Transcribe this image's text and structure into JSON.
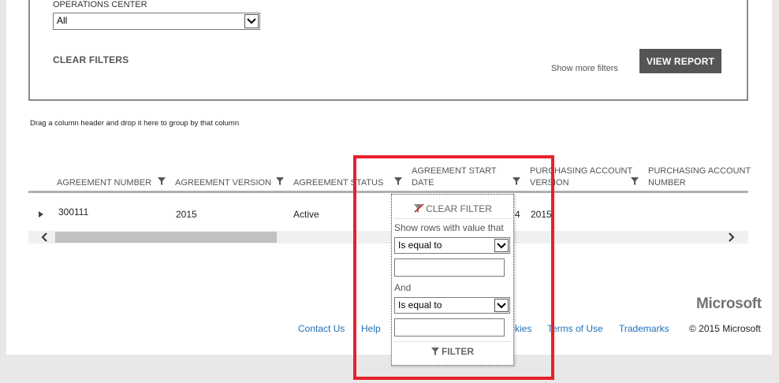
{
  "filters": {
    "operations_center_label": "OPERATIONS CENTER",
    "operations_center_value": "All",
    "clear_filters_label": "CLEAR FILTERS",
    "show_more_filters_label": "Show more filters",
    "view_report_label": "VIEW REPORT"
  },
  "grid": {
    "group_hint": "Drag a column header and drop it here to group by that column",
    "columns": [
      {
        "line1": "",
        "line2": "AGREEMENT NUMBER"
      },
      {
        "line1": "",
        "line2": "AGREEMENT VERSION"
      },
      {
        "line1": "",
        "line2": "AGREEMENT STATUS"
      },
      {
        "line1": "AGREEMENT START",
        "line2": "DATE"
      },
      {
        "line1": "PURCHASING ACCOUNT",
        "line2": "VERSION"
      },
      {
        "line1": "PURCHASING ACCOUNT",
        "line2": "NUMBER"
      }
    ],
    "row": {
      "agreement_number": "300111",
      "agreement_version": "2015",
      "agreement_status": "Active",
      "start_date_fragment": "4",
      "purchasing_account_version": "2015"
    }
  },
  "filter_popup": {
    "clear_filter_label": "CLEAR FILTER",
    "show_rows_label": "Show rows with value that",
    "operator1": "Is equal to",
    "value1": "",
    "and_label": "And",
    "operator2": "Is equal to",
    "value2": "",
    "filter_button_label": "FILTER"
  },
  "footer": {
    "brand": "Microsoft",
    "links": {
      "contact_us": "Contact Us",
      "help": "Help",
      "cookies": "kies",
      "terms_of_use": "Terms of Use",
      "trademarks": "Trademarks"
    },
    "copyright": "© 2015 Microsoft"
  },
  "colors": {
    "highlight": "#e8202a",
    "link": "#1f6fb5",
    "button_bg": "#555555"
  }
}
